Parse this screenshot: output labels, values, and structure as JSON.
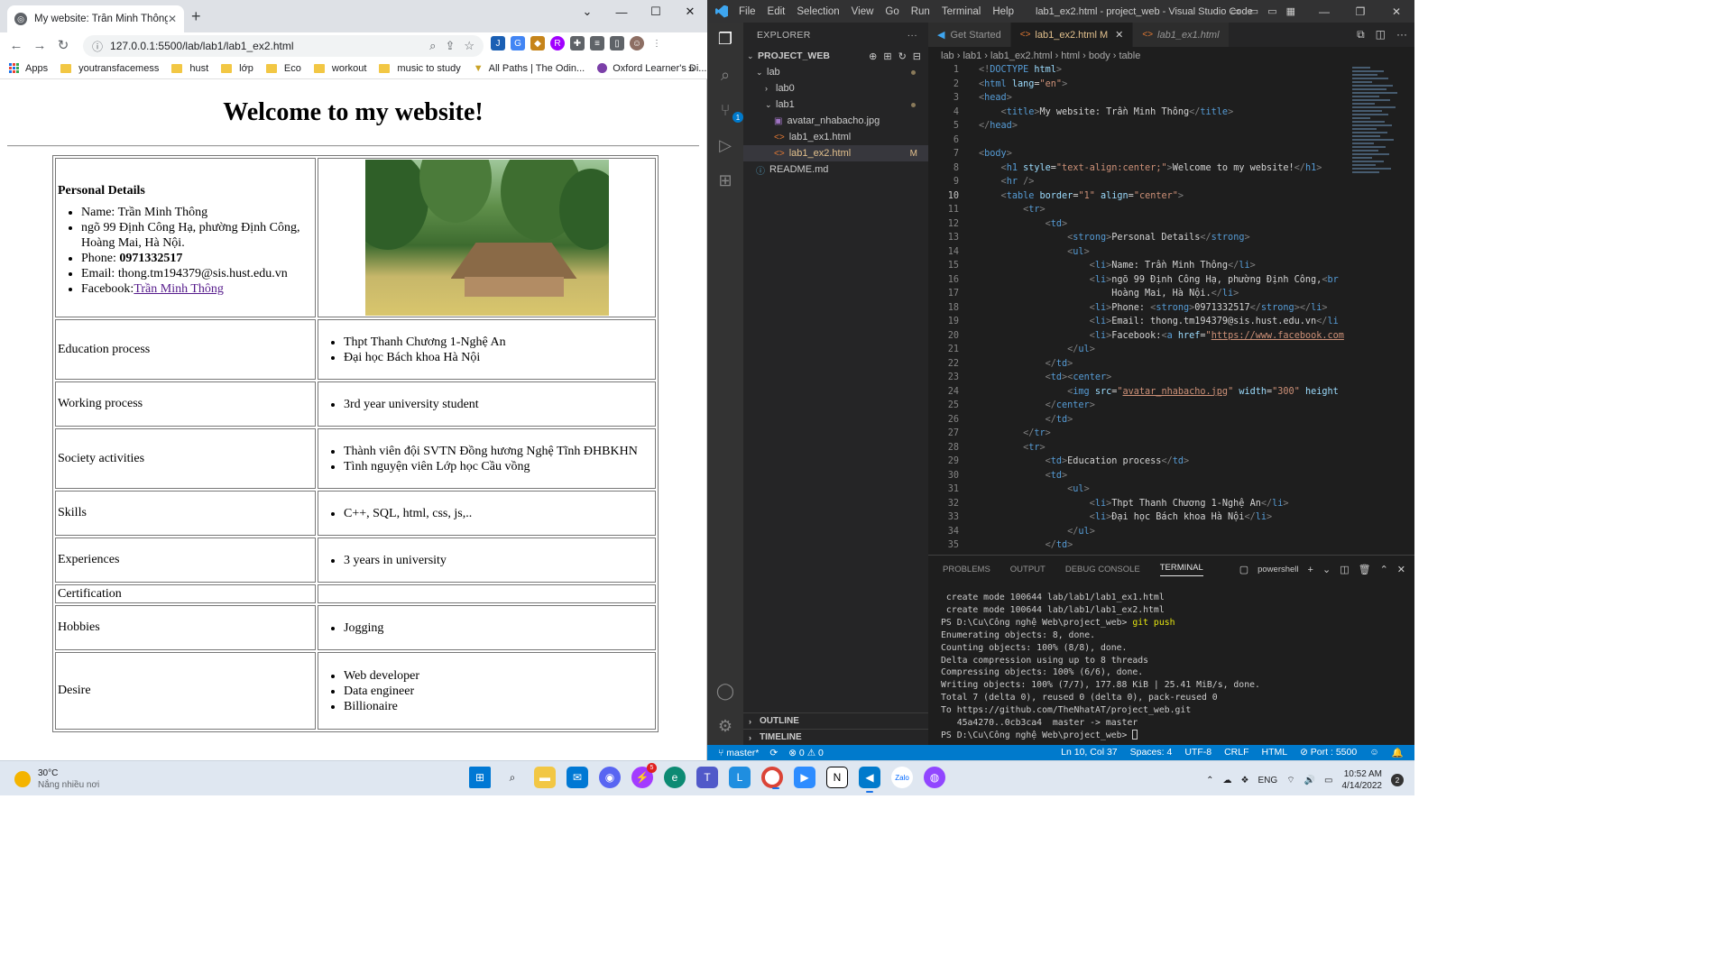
{
  "browser": {
    "tab_title": "My website: Trần Minh Thông",
    "url": "127.0.0.1:5500/lab/lab1/lab1_ex2.html",
    "bookmarks": [
      "Apps",
      "youtransfacemess",
      "hust",
      "lớp",
      "Eco",
      "workout",
      "music to study",
      "All Paths | The Odin...",
      "Oxford Learner's Di..."
    ],
    "more": "»"
  },
  "page": {
    "heading": "Welcome to my website!",
    "personal_title": "Personal Details",
    "name": "Name: Trần Minh Thông",
    "address": "ngõ 99 Định Công Hạ, phường Định Công,",
    "address2": "Hoàng Mai, Hà Nội.",
    "phone_label": "Phone: ",
    "phone": "0971332517",
    "email": "Email: thong.tm194379@sis.hust.edu.vn",
    "facebook_label": "Facebook:",
    "facebook_link": "Trần Minh Thông",
    "rows": [
      {
        "label": "Education process",
        "items": [
          "Thpt Thanh Chương 1-Nghệ An",
          "Đại học Bách khoa Hà Nội"
        ]
      },
      {
        "label": "Working process",
        "items": [
          "3rd year university student"
        ]
      },
      {
        "label": "Society activities",
        "items": [
          "Thành viên đội SVTN Đồng hương Nghệ Tĩnh ĐHBKHN",
          "Tình nguyện viên Lớp học Cầu vồng"
        ]
      },
      {
        "label": "Skills",
        "items": [
          "C++, SQL, html, css, js,.."
        ]
      },
      {
        "label": "Experiences",
        "items": [
          "3 years in university"
        ]
      },
      {
        "label": "Certification",
        "items": []
      },
      {
        "label": "Hobbies",
        "items": [
          "Jogging"
        ]
      },
      {
        "label": "Desire",
        "items": [
          "Web developer",
          "Data engineer",
          "Billionaire"
        ]
      }
    ]
  },
  "vscode": {
    "menu": [
      "File",
      "Edit",
      "Selection",
      "View",
      "Go",
      "Run",
      "Terminal",
      "Help"
    ],
    "window_title": "lab1_ex2.html - project_web - Visual Studio Code",
    "explorer_header": "EXPLORER",
    "project": "PROJECT_WEB",
    "tree": [
      {
        "name": "lab",
        "type": "folder-open",
        "depth": 0
      },
      {
        "name": "lab0",
        "type": "folder",
        "depth": 1
      },
      {
        "name": "lab1",
        "type": "folder-open",
        "depth": 1
      },
      {
        "name": "avatar_nhabacho.jpg",
        "type": "image",
        "depth": 2
      },
      {
        "name": "lab1_ex1.html",
        "type": "html",
        "depth": 2
      },
      {
        "name": "lab1_ex2.html",
        "type": "html",
        "depth": 2,
        "selected": true,
        "mark": "M"
      },
      {
        "name": "README.md",
        "type": "info",
        "depth": 0
      }
    ],
    "outline": "OUTLINE",
    "timeline": "TIMELINE",
    "tabs": [
      {
        "label": "Get Started",
        "active": false
      },
      {
        "label": "lab1_ex2.html M",
        "active": true
      },
      {
        "label": "lab1_ex1.html",
        "active": false,
        "italic": true
      }
    ],
    "breadcrumb": "lab  ›  lab1  ›  lab1_ex2.html  ›  html  ›  body  ›  table",
    "panel_tabs": [
      "PROBLEMS",
      "OUTPUT",
      "DEBUG CONSOLE",
      "TERMINAL"
    ],
    "shell": "powershell",
    "terminal": [
      " create mode 100644 lab/lab1/lab1_ex1.html",
      " create mode 100644 lab/lab1/lab1_ex2.html",
      "PS D:\\Cu\\Công nghệ Web\\project_web> git push",
      "Enumerating objects: 8, done.",
      "Counting objects: 100% (8/8), done.",
      "Delta compression using up to 8 threads",
      "Compressing objects: 100% (6/6), done.",
      "Writing objects: 100% (7/7), 177.88 KiB | 25.41 MiB/s, done.",
      "Total 7 (delta 0), reused 0 (delta 0), pack-reused 0",
      "To https://github.com/TheNhatAT/project_web.git",
      "   45a4270..0cb3ca4  master -> master",
      "PS D:\\Cu\\Công nghệ Web\\project_web> "
    ],
    "status": {
      "branch": "master*",
      "problems": "⊗ 0 ⚠ 0",
      "position": "Ln 10, Col 37",
      "spaces": "Spaces: 4",
      "encoding": "UTF-8",
      "eol": "CRLF",
      "lang": "HTML",
      "port": "⊘ Port : 5500"
    }
  },
  "taskbar": {
    "temp": "30°C",
    "weather": "Nắng nhiều nơi",
    "lang": "ENG",
    "time": "10:52 AM",
    "date": "4/14/2022",
    "notifications": "2",
    "messenger_badge": "5"
  }
}
